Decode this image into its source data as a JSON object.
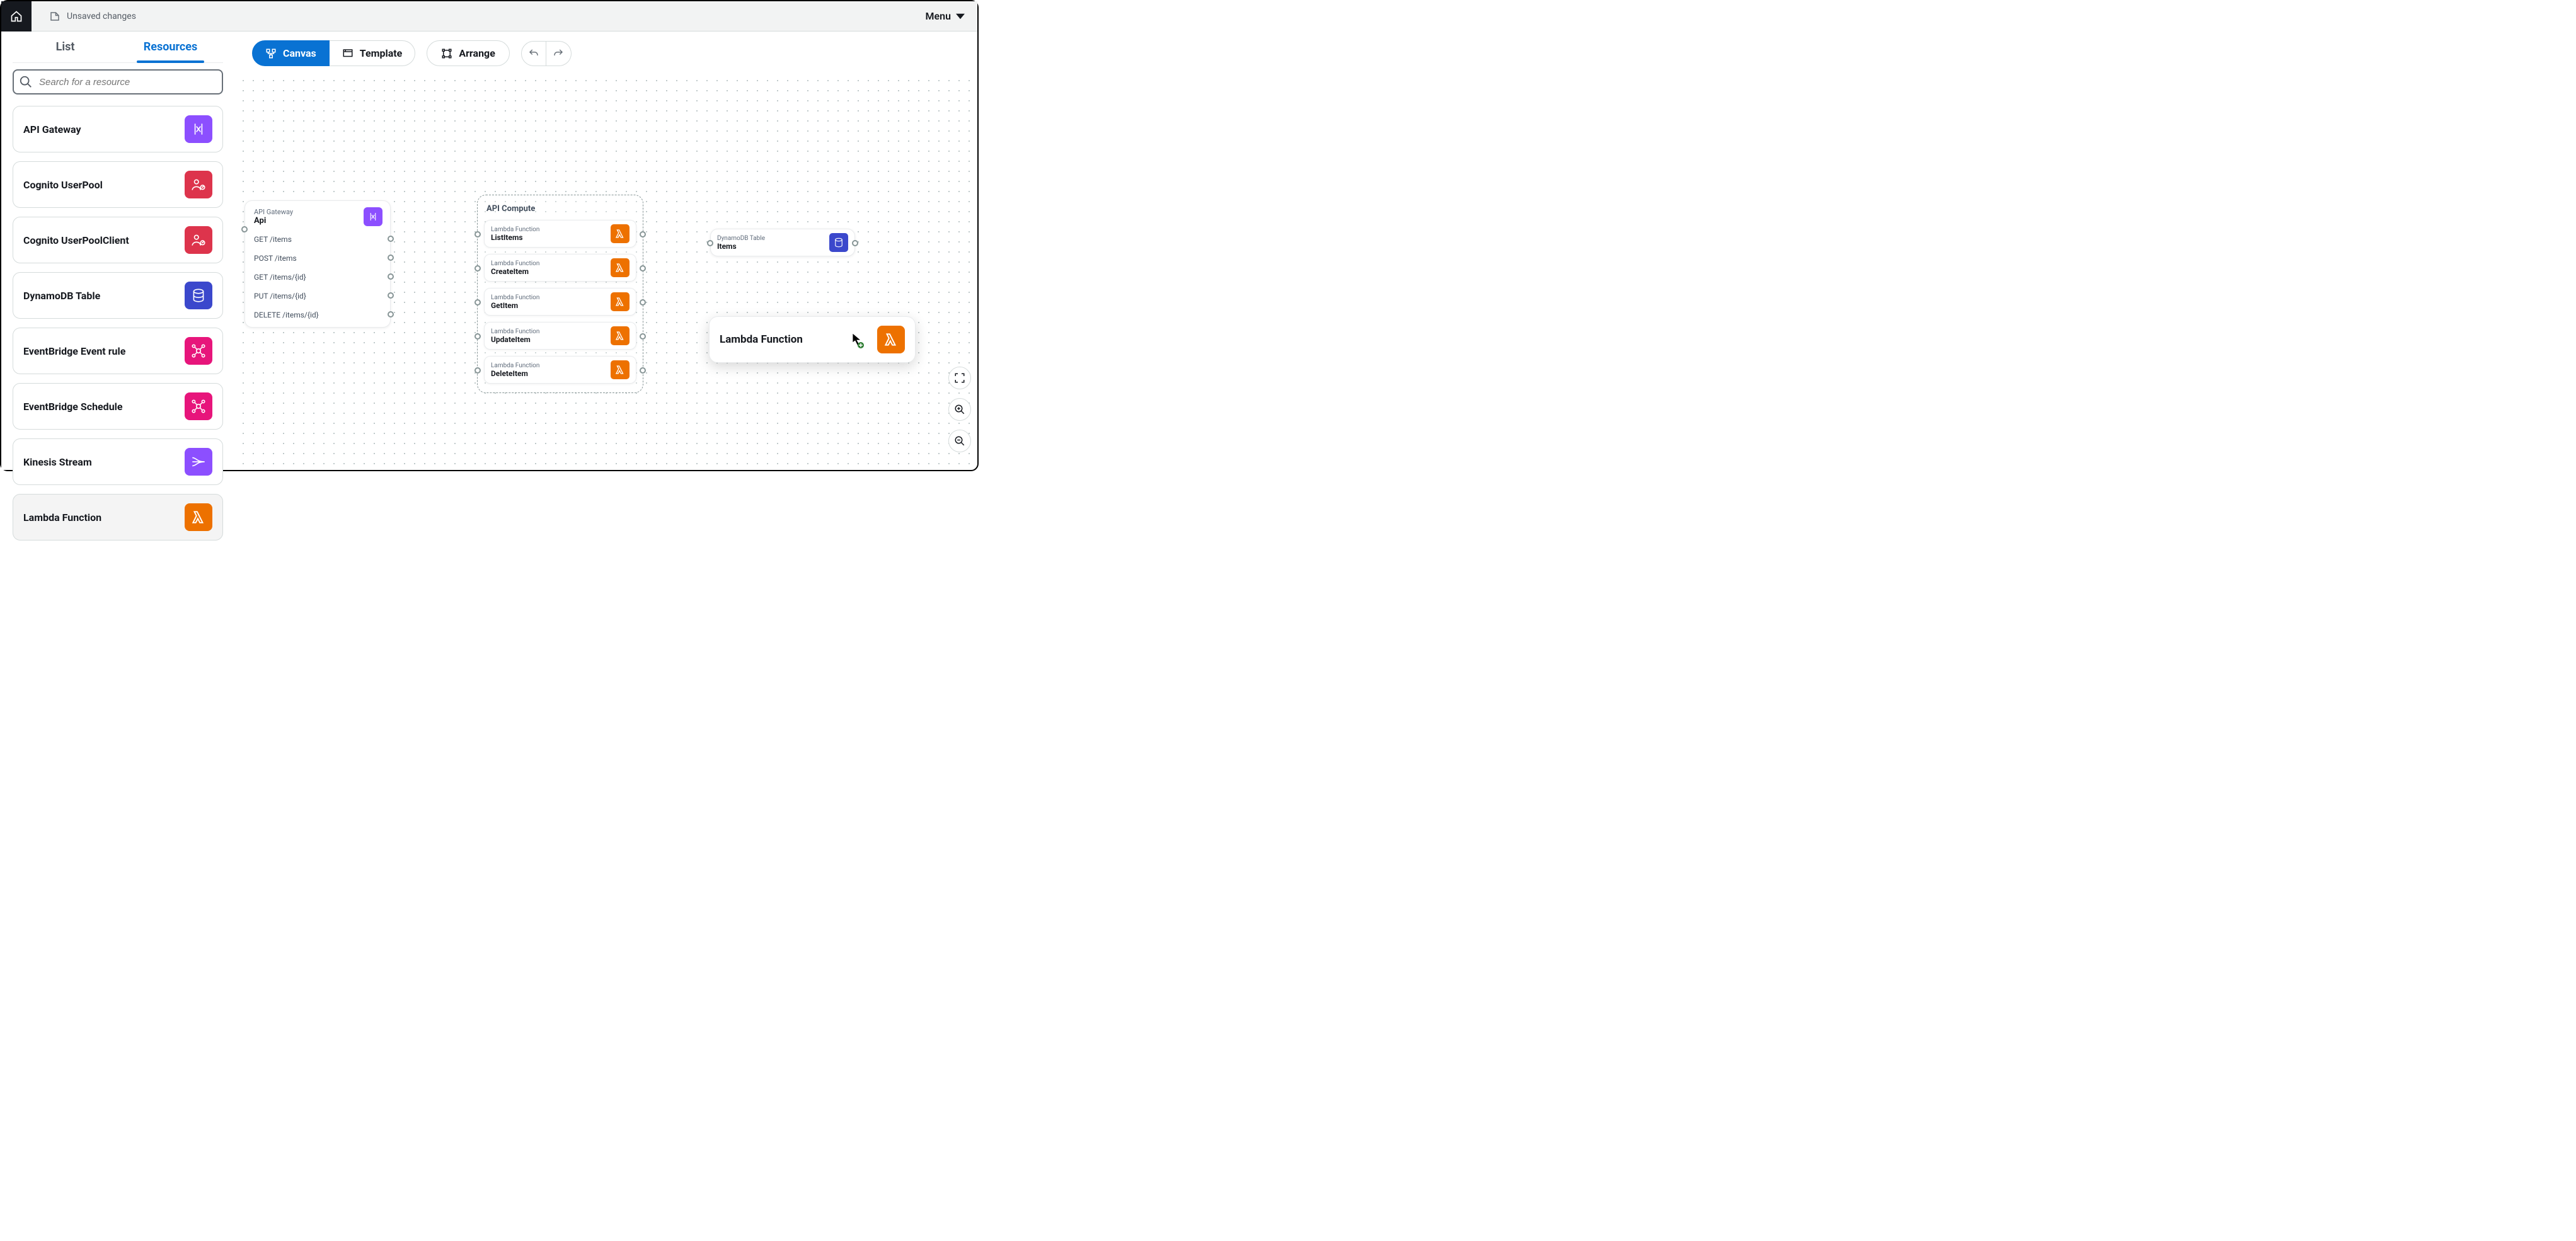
{
  "topbar": {
    "status": "Unsaved changes",
    "menu_label": "Menu"
  },
  "sidebar": {
    "tabs": {
      "list": "List",
      "resources": "Resources"
    },
    "search_placeholder": "Search for a resource",
    "items": [
      {
        "name": "API Gateway",
        "color": "#8c4fff",
        "icon": "api-gateway"
      },
      {
        "name": "Cognito UserPool",
        "color": "#dd344c",
        "icon": "cognito"
      },
      {
        "name": "Cognito UserPoolClient",
        "color": "#dd344c",
        "icon": "cognito"
      },
      {
        "name": "DynamoDB Table",
        "color": "#3b48cc",
        "icon": "dynamodb"
      },
      {
        "name": "EventBridge Event rule",
        "color": "#e7157b",
        "icon": "eventbridge"
      },
      {
        "name": "EventBridge Schedule",
        "color": "#e7157b",
        "icon": "eventbridge"
      },
      {
        "name": "Kinesis Stream",
        "color": "#8c4fff",
        "icon": "kinesis"
      },
      {
        "name": "Lambda Function",
        "color": "#ed7100",
        "icon": "lambda",
        "highlighted": true
      }
    ]
  },
  "toolbar": {
    "canvas": "Canvas",
    "template": "Template",
    "arrange": "Arrange"
  },
  "canvas": {
    "api_node": {
      "type": "API Gateway",
      "name": "Api",
      "routes": [
        "GET /items",
        "POST /items",
        "GET /items/{id}",
        "PUT /items/{id}",
        "DELETE /items/{id}"
      ]
    },
    "group_title": "API Compute",
    "lambdas": [
      {
        "type": "Lambda Function",
        "name": "ListItems"
      },
      {
        "type": "Lambda Function",
        "name": "CreateItem"
      },
      {
        "type": "Lambda Function",
        "name": "GetItem"
      },
      {
        "type": "Lambda Function",
        "name": "UpdateItem"
      },
      {
        "type": "Lambda Function",
        "name": "DeleteItem"
      }
    ],
    "dynamo": {
      "type": "DynamoDB Table",
      "name": "Items"
    },
    "ghost_label": "Lambda Function"
  }
}
